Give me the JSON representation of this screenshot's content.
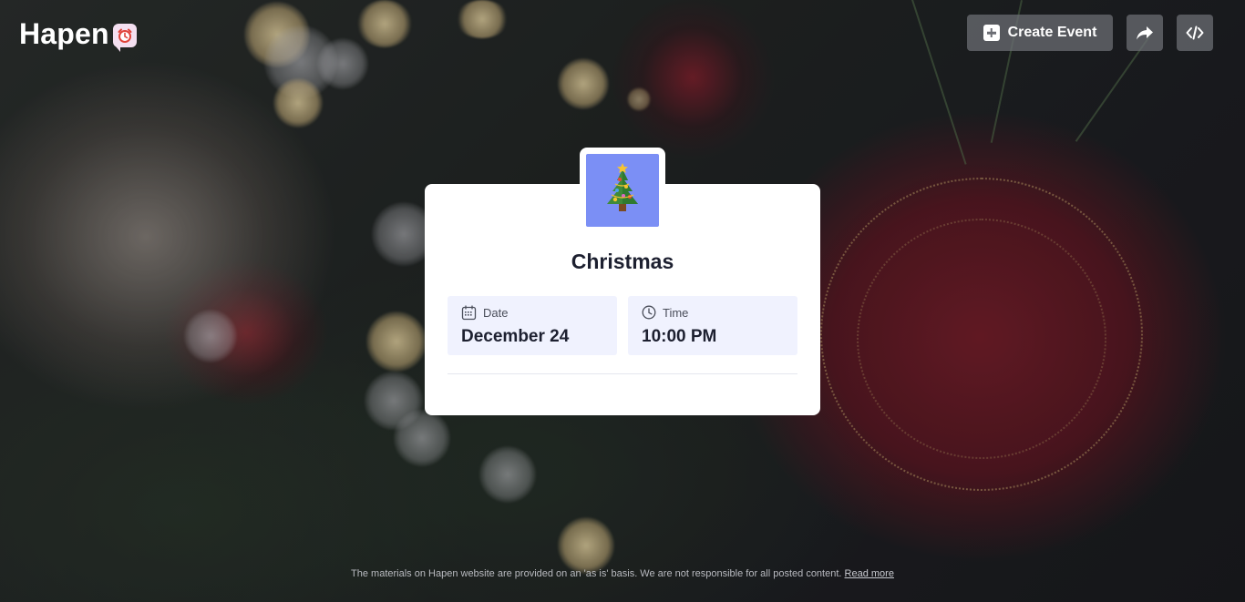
{
  "header": {
    "logo_text": "Hapen",
    "logo_icon": "alarm-clock-icon",
    "create_event_label": "Create Event",
    "share_icon": "share-arrow-icon",
    "embed_icon": "code-embed-icon"
  },
  "event": {
    "emoji": "🎄",
    "emoji_background": "#7b8ff5",
    "title": "Christmas",
    "date_label": "Date",
    "date_value": "December 24",
    "time_label": "Time",
    "time_value": "10:00 PM"
  },
  "footer": {
    "text": "The materials on Hapen website are provided on an 'as is' basis. We are not responsible for all posted content.",
    "read_more": "Read more"
  },
  "colors": {
    "card_background": "#ffffff",
    "info_box_background": "#f0f2fe",
    "button_background": "#6e7076"
  }
}
